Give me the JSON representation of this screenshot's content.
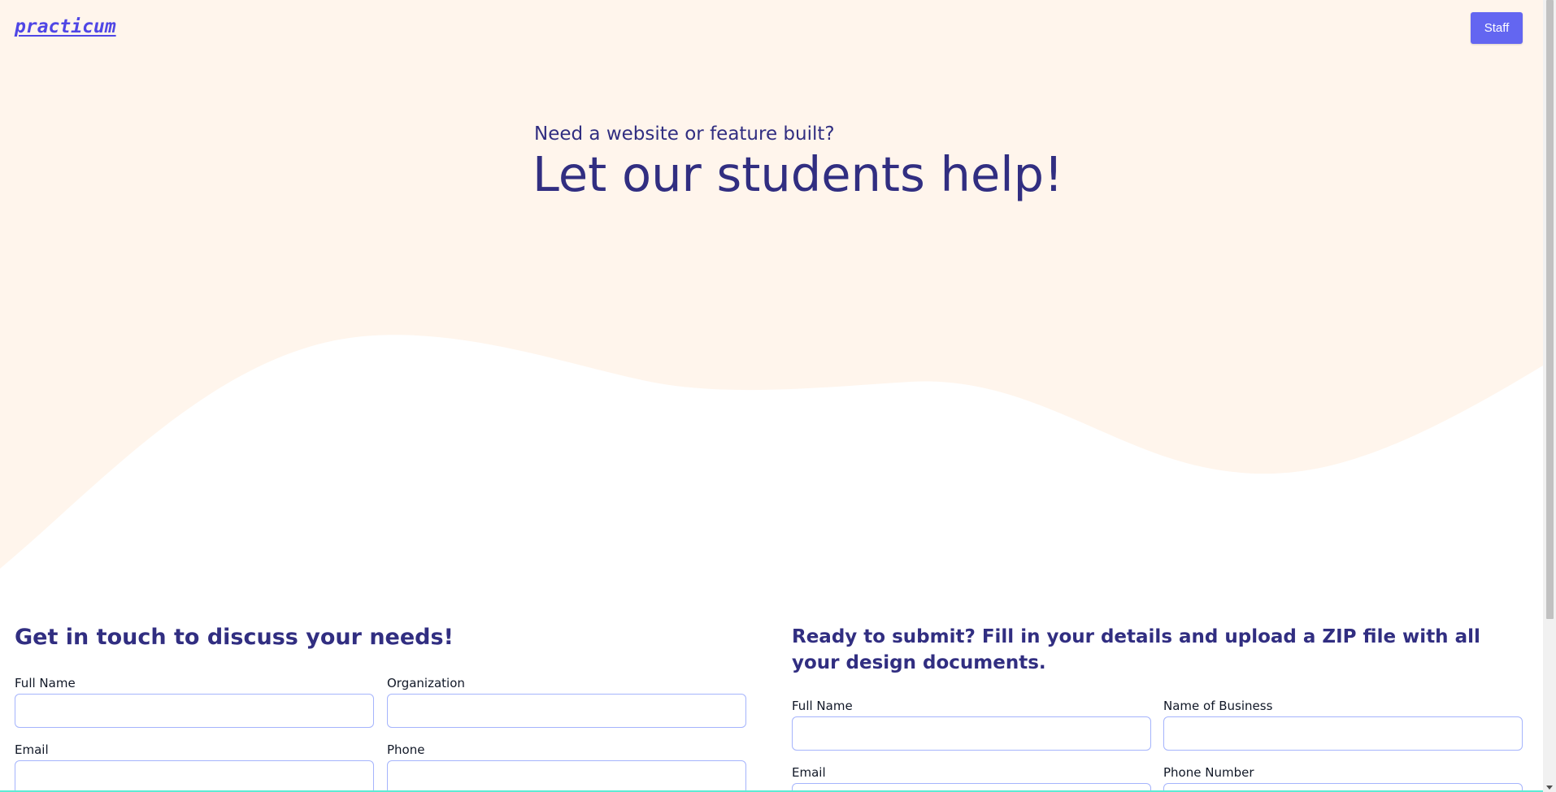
{
  "header": {
    "logo": "practicum",
    "staff_button": "Staff"
  },
  "hero": {
    "subtitle": "Need a website or feature built?",
    "title": "Let our students help!"
  },
  "contact_form": {
    "heading": "Get in touch to discuss your needs!",
    "fields": [
      {
        "label": "Full Name",
        "value": ""
      },
      {
        "label": "Organization",
        "value": ""
      },
      {
        "label": "Email",
        "value": ""
      },
      {
        "label": "Phone",
        "value": ""
      }
    ]
  },
  "submit_form": {
    "heading": "Ready to submit? Fill in your details and upload a ZIP file with all your design documents.",
    "fields": [
      {
        "label": "Full Name",
        "value": ""
      },
      {
        "label": "Name of Business",
        "value": ""
      },
      {
        "label": "Email",
        "value": ""
      },
      {
        "label": "Phone Number",
        "value": ""
      }
    ]
  },
  "colors": {
    "hero_background": "#fff5ec",
    "primary": "#6366f1",
    "heading_text": "#312e81",
    "input_border": "#a5b4fc"
  }
}
